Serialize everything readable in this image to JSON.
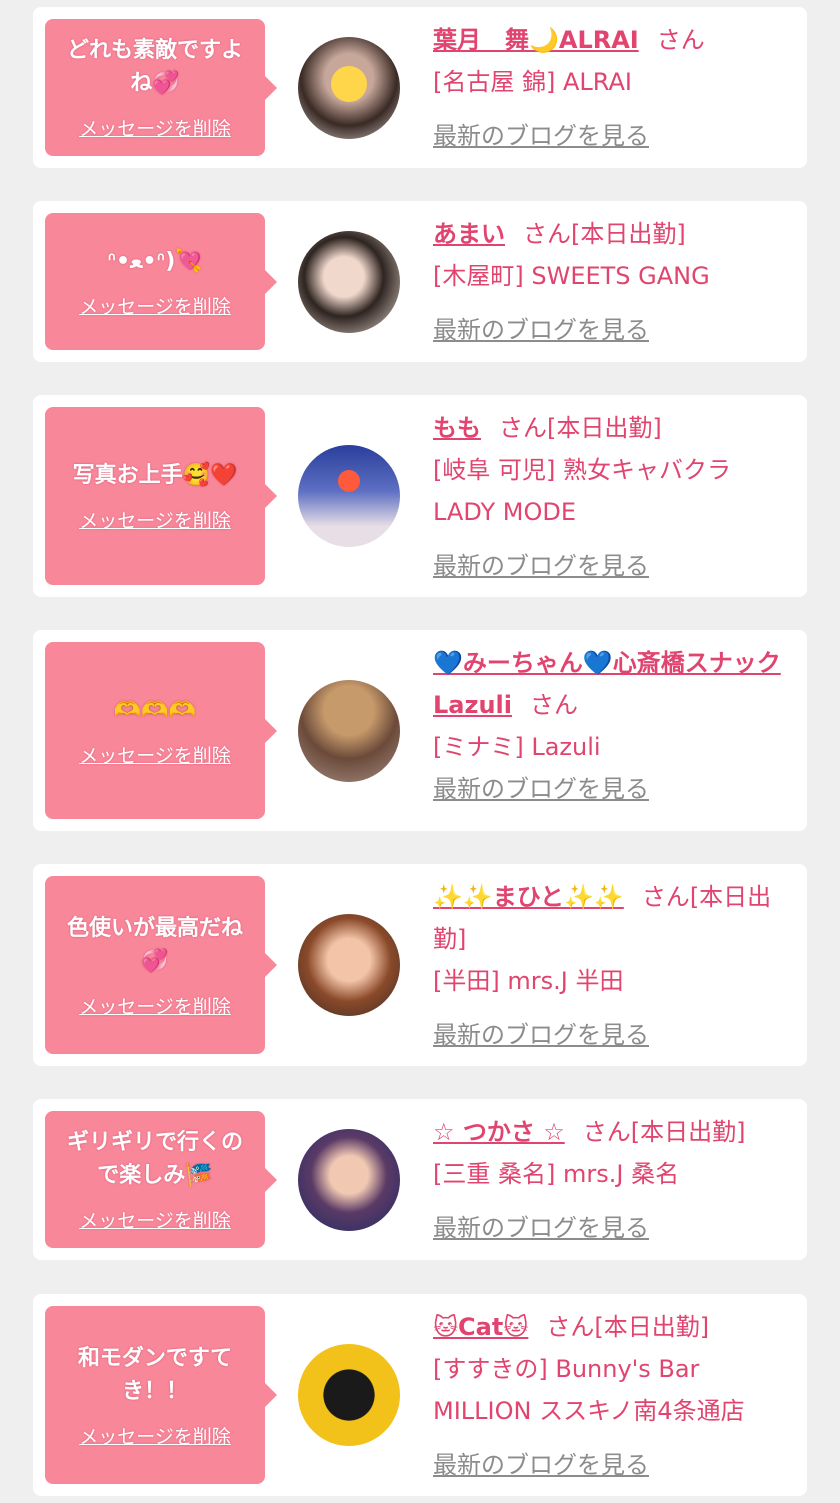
{
  "delete_label": "メッセージを削除",
  "blog_label": "最新のブログを見る",
  "san_label": "さん",
  "cards": [
    {
      "message": "どれも素敵ですよね💞",
      "name": "葉月　舞🌙ALRAI",
      "status": "",
      "shop": "[名古屋 錦] ALRAI"
    },
    {
      "message": "ᐢ•ﻌ•ᐢ)💘",
      "name": "あまい",
      "status": "[本日出勤]",
      "shop": "[木屋町] SWEETS GANG"
    },
    {
      "message": "写真お上手🥰❤️",
      "name": "もも",
      "status": "[本日出勤]",
      "shop": "[岐阜 可児] 熟女キャバクラ LADY MODE"
    },
    {
      "message": "🫶🫶🫶",
      "name": "💙みーちゃん💙心斎橋スナックLazuli",
      "status": "",
      "shop": "[ミナミ] Lazuli"
    },
    {
      "message": "色使いが最高だね💞",
      "name": "✨✨まひと✨✨",
      "status": "[本日出勤]",
      "shop": "[半田] mrs.J 半田"
    },
    {
      "message": "ギリギリで行くので楽しみ🎏",
      "name": "☆ つかさ ☆",
      "status": "[本日出勤]",
      "shop": "[三重 桑名] mrs.J 桑名"
    },
    {
      "message": "和モダンですてき！！",
      "name": "🐱Cat🐱",
      "status": "[本日出勤]",
      "shop": "[すすきの] Bunny's Bar MILLION ススキノ南4条通店"
    }
  ]
}
